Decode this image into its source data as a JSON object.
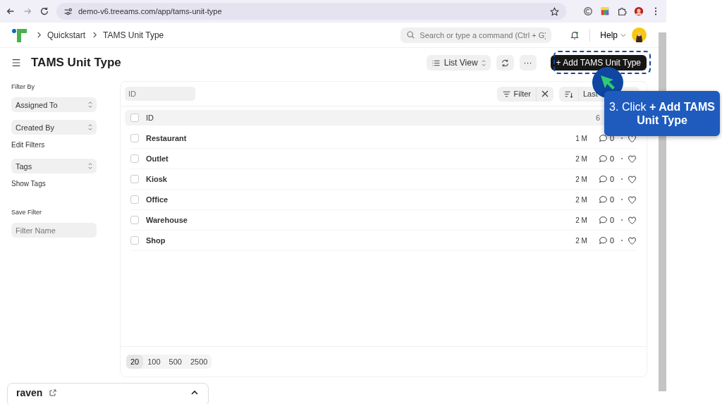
{
  "browser": {
    "url": "demo-v6.treeams.com/app/tams-unit-type"
  },
  "navbar": {
    "breadcrumbs": [
      "Quickstart",
      "TAMS Unit Type"
    ],
    "search": {
      "placeholder": "Search or type a command (Ctrl + G)"
    },
    "help": "Help"
  },
  "page": {
    "title": "TAMS Unit Type",
    "view_button": "List View",
    "more_button": "···",
    "primary_button": "+ Add TAMS Unit Type"
  },
  "sidebar": {
    "filter_by": "Filter By",
    "selects": [
      "Assigned To",
      "Created By"
    ],
    "edit_filters": "Edit Filters",
    "tags_select": "Tags",
    "show_tags": "Show Tags",
    "save_filter": "Save Filter",
    "filter_name": {
      "placeholder": "Filter Name"
    }
  },
  "list": {
    "id_filter": {
      "placeholder": "ID"
    },
    "filter_button": "Filter",
    "sort_label": "Last",
    "header": {
      "label": "ID",
      "count": "6",
      "checked": false
    },
    "rows": [
      {
        "name": "Restaurant",
        "modified": "1 M",
        "comments": "0",
        "checked": false
      },
      {
        "name": "Outlet",
        "modified": "2 M",
        "comments": "0",
        "checked": false
      },
      {
        "name": "Kiosk",
        "modified": "2 M",
        "comments": "0",
        "checked": false
      },
      {
        "name": "Office",
        "modified": "2 M",
        "comments": "0",
        "checked": false
      },
      {
        "name": "Warehouse",
        "modified": "2 M",
        "comments": "0",
        "checked": false
      },
      {
        "name": "Shop",
        "modified": "2 M",
        "comments": "0",
        "checked": false
      }
    ],
    "page_sizes": [
      {
        "label": "20",
        "selected": true
      },
      {
        "label": "100",
        "selected": false
      },
      {
        "label": "500",
        "selected": false
      },
      {
        "label": "2500",
        "selected": false
      }
    ]
  },
  "raven": {
    "title": "raven"
  },
  "tutorial": {
    "step": "3. Click **+ Add TAMS Unit Type**"
  }
}
